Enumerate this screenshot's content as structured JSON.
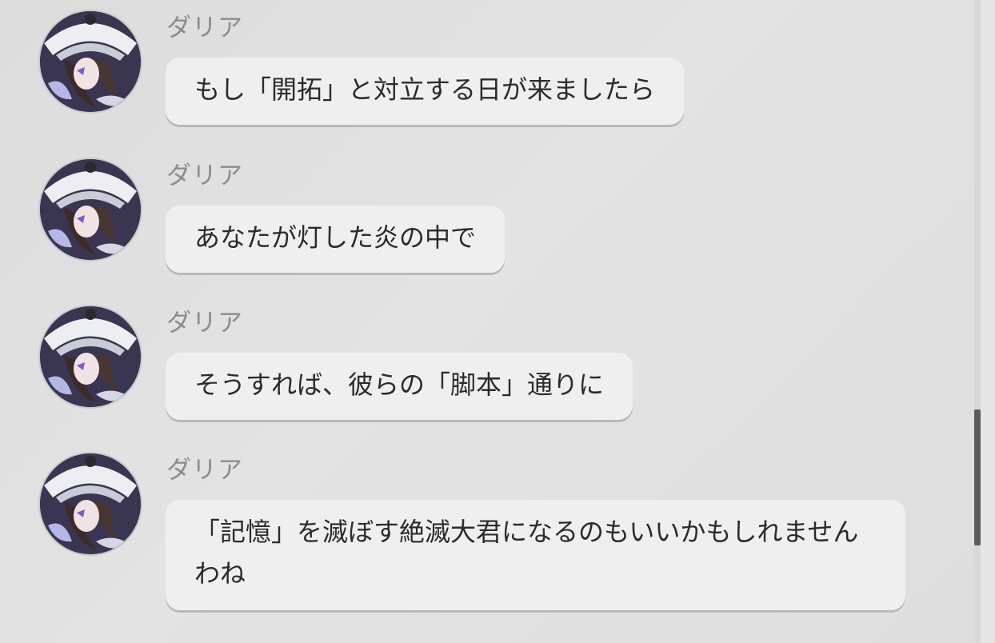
{
  "messages": [
    {
      "sender": "ダリア",
      "text": "もし「開拓」と対立する日が来ましたら"
    },
    {
      "sender": "ダリア",
      "text": "あなたが灯した炎の中で"
    },
    {
      "sender": "ダリア",
      "text": "そうすれば、彼らの「脚本」通りに"
    },
    {
      "sender": "ダリア",
      "text": "「記憶」を滅ぼす絶滅大君になるのもいいかもしれませんわね"
    }
  ],
  "scroll_position": 0.82,
  "colors": {
    "background": "#e0e0e0",
    "bubble": "#efefef",
    "sender_text": "#8c8c8c",
    "message_text": "#2b2b2b",
    "scrollbar_thumb": "#5c5c5c"
  }
}
